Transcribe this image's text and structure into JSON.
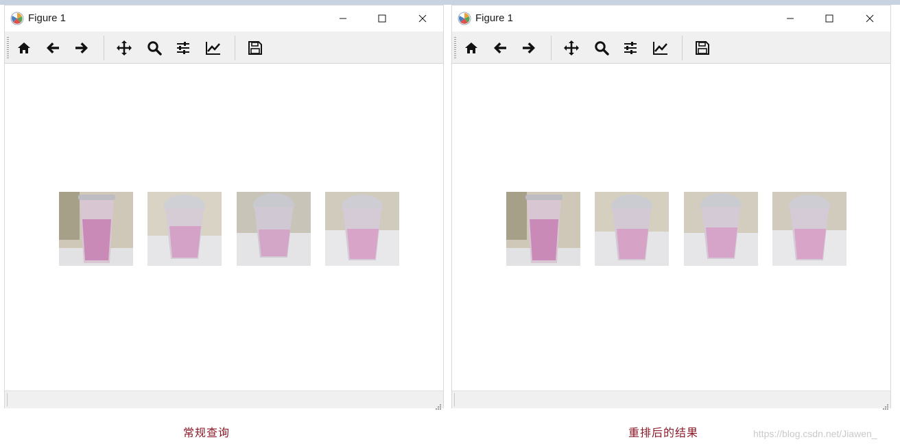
{
  "windows": [
    {
      "title": "Figure 1",
      "toolbar": [
        "home-icon",
        "back-arrow-icon",
        "forward-arrow-icon",
        "pan-icon",
        "zoom-icon",
        "subplots-icon",
        "axes-icon",
        "save-icon"
      ],
      "images": [
        "cup-image-1",
        "cup-image-2",
        "cup-image-3",
        "cup-image-4"
      ]
    },
    {
      "title": "Figure 1",
      "toolbar": [
        "home-icon",
        "back-arrow-icon",
        "forward-arrow-icon",
        "pan-icon",
        "zoom-icon",
        "subplots-icon",
        "axes-icon",
        "save-icon"
      ],
      "images": [
        "cup-image-1",
        "cup-image-2",
        "cup-image-3",
        "cup-image-4"
      ]
    }
  ],
  "captions": {
    "left": "常规查询",
    "right": "重排后的结果"
  },
  "watermark": "https://blog.csdn.net/Jiawen_",
  "colors": {
    "caption": "#8b1a2a",
    "toolbar_bg": "#f0f0f0",
    "icon": "#111111"
  }
}
